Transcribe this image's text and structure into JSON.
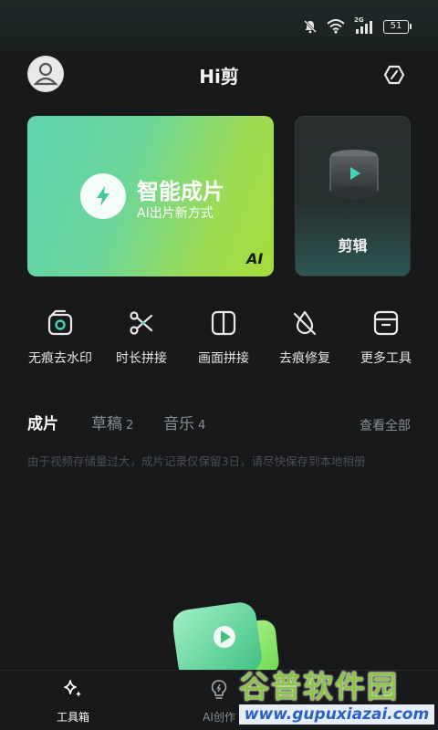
{
  "status_bar": {
    "signal_label": "2G",
    "battery": "51",
    "icons": [
      "bell-mute-icon",
      "wifi-icon",
      "signal-icon",
      "battery-icon"
    ]
  },
  "header": {
    "title": "Hi剪",
    "avatar_icon": "user-avatar-icon",
    "settings_icon": "hexagon-settings-icon"
  },
  "cards": {
    "smart": {
      "title": "智能成片",
      "subtitle": "AI出片新方式",
      "badge": "AI",
      "icon": "lightning-icon"
    },
    "edit": {
      "label": "剪辑",
      "icon": "film-play-icon"
    }
  },
  "tools": [
    {
      "label": "无痕去水印",
      "icon": "camera-frame-icon"
    },
    {
      "label": "时长拼接",
      "icon": "scissors-icon"
    },
    {
      "label": "画面拼接",
      "icon": "split-frame-icon"
    },
    {
      "label": "去痕修复",
      "icon": "drop-slash-icon"
    },
    {
      "label": "更多工具",
      "icon": "box-icon"
    }
  ],
  "tabs": {
    "items": [
      {
        "label": "成片",
        "count": ""
      },
      {
        "label": "草稿",
        "count": "2"
      },
      {
        "label": "音乐",
        "count": "4"
      }
    ],
    "view_all": "查看全部"
  },
  "notice": "由于视频存储量过大，成片记录仅保留3日，请尽快保存到本地相册",
  "bottom_nav": [
    {
      "label": "工具箱",
      "icon": "sparkle-icon"
    },
    {
      "label": "AI创作",
      "icon": "bulb-icon"
    }
  ],
  "watermark": {
    "title": "谷普软件园",
    "url": "www.gupuxiazai.com"
  },
  "colors": {
    "background": "#17191b",
    "card_gradient_start": "#5fd4b0",
    "card_gradient_end": "#a6dc3a",
    "accent_teal": "#3fd5b6"
  }
}
